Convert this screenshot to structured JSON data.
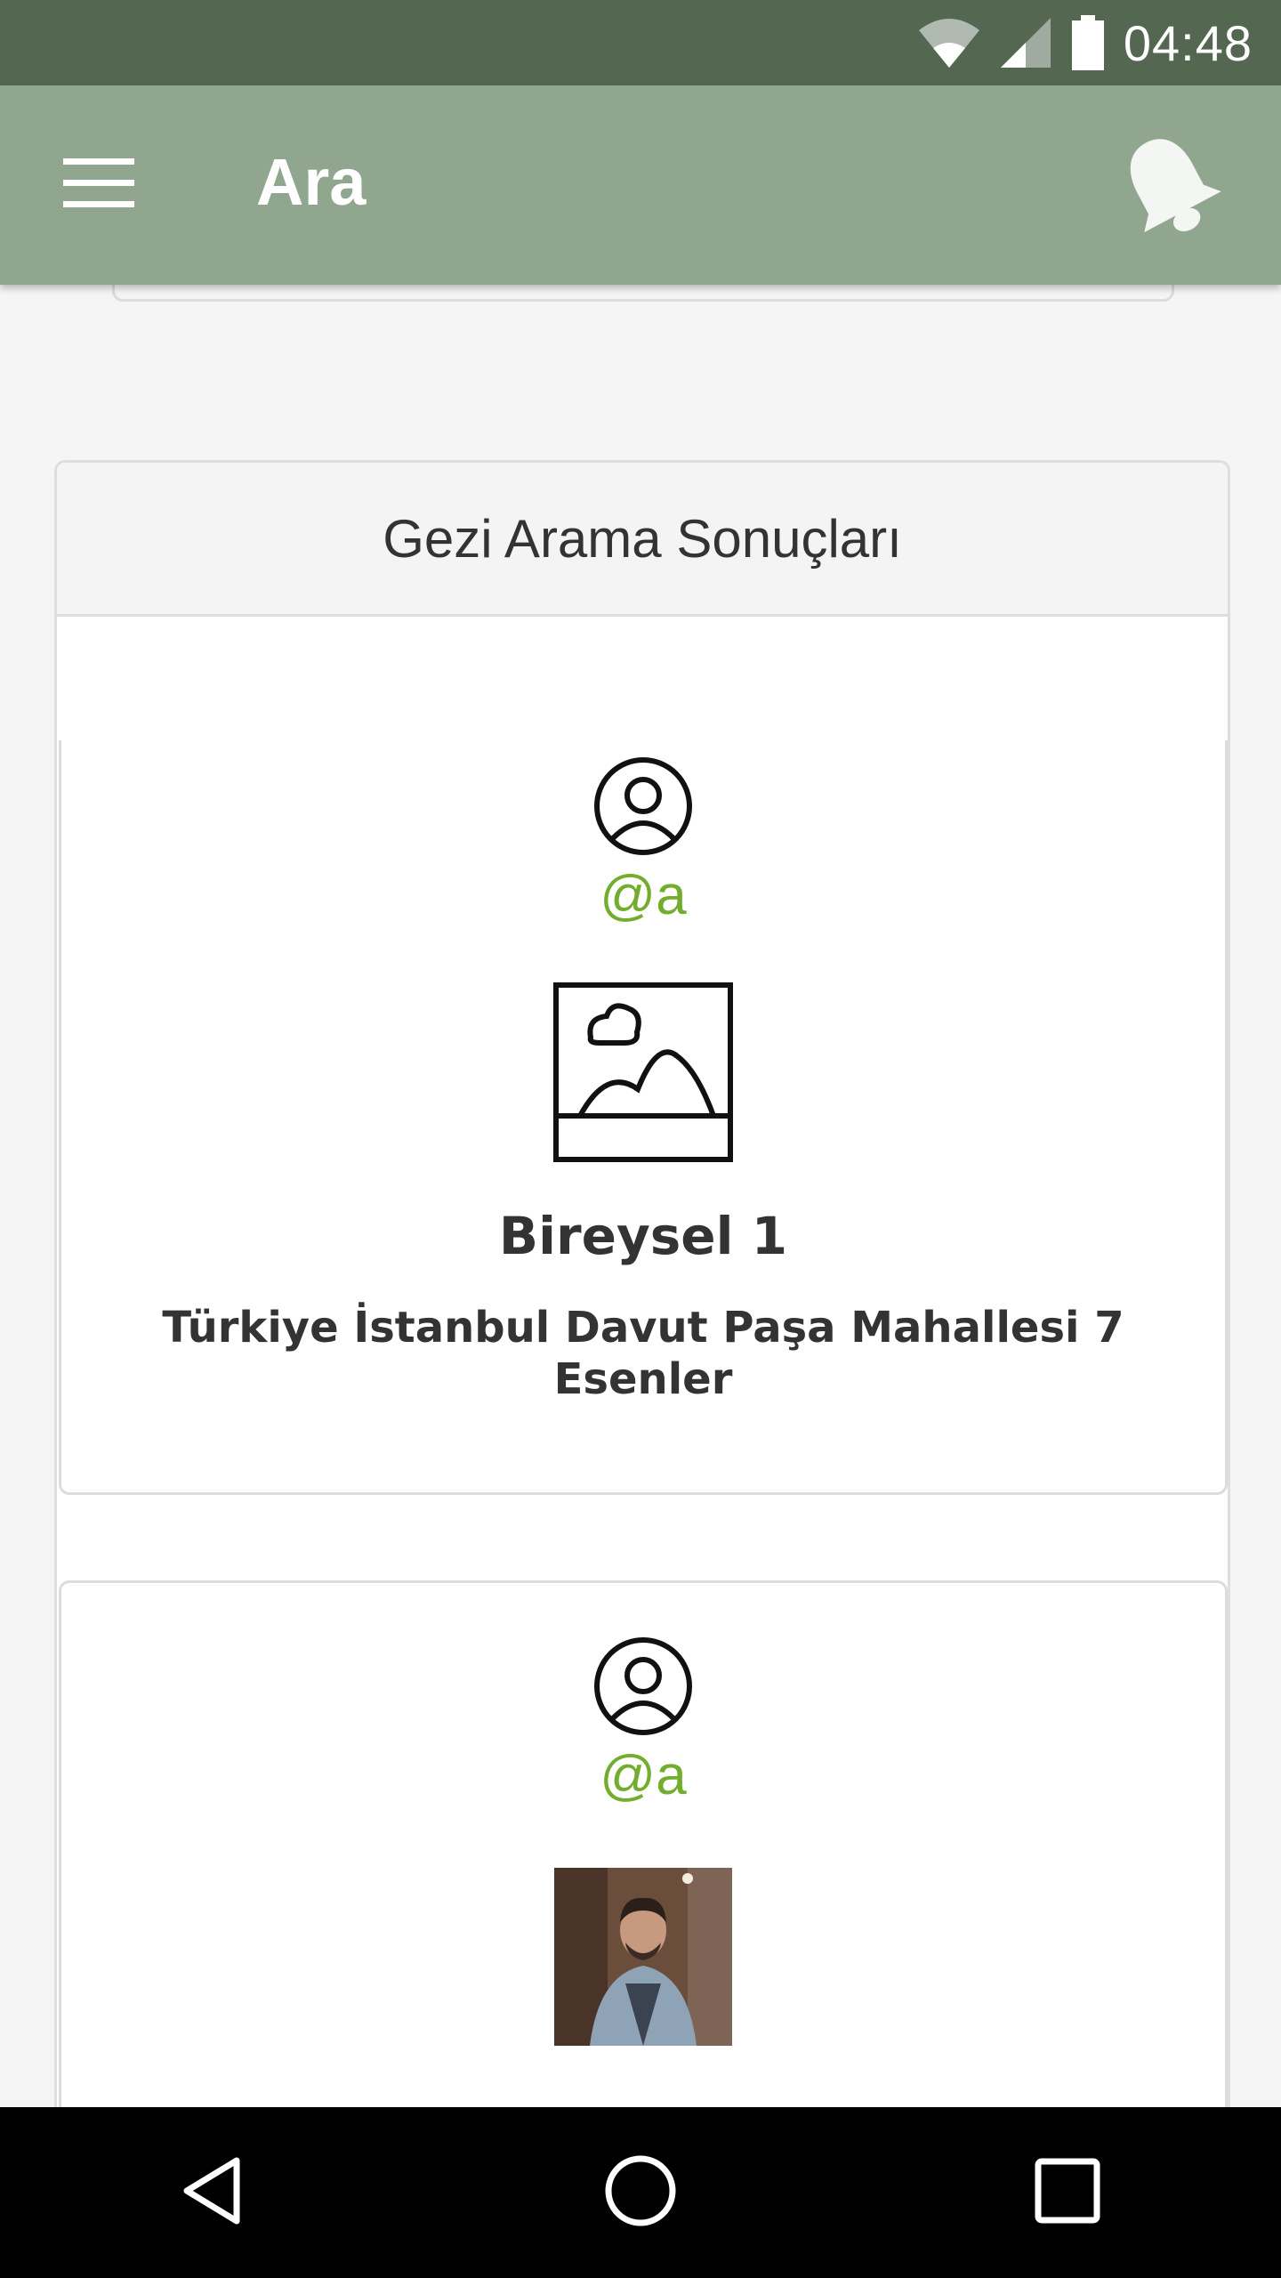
{
  "status_bar": {
    "time": "04:48",
    "icons": [
      "wifi-icon",
      "cell-signal-icon",
      "battery-icon"
    ]
  },
  "app_bar": {
    "title": "Ara",
    "menu_icon": "hamburger-menu-icon",
    "bell_icon": "bell-icon",
    "background": "#91a68f"
  },
  "results_panel": {
    "header": "Gezi Arama Sonuçları",
    "items": [
      {
        "username": "@a",
        "image": "placeholder-image-icon",
        "title": "Bireysel 1",
        "address": "Türkiye İstanbul Davut Paşa Mahallesi 7 Esenler"
      },
      {
        "username": "@a",
        "image": "user-photo"
      }
    ]
  },
  "colors": {
    "status_bar": "#536751",
    "accent_username": "#73ad2e"
  },
  "nav_bar": {
    "icons": [
      "back-icon",
      "home-icon",
      "recents-icon"
    ]
  }
}
